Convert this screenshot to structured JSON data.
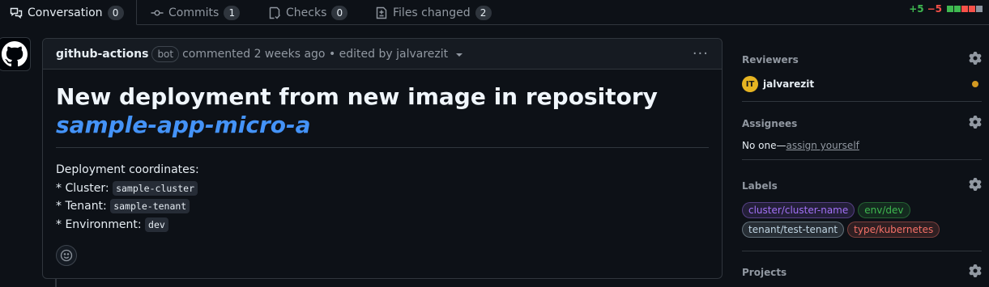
{
  "tabs": [
    {
      "label": "Conversation",
      "count": "0",
      "icon": "comment-discussion-icon",
      "active": true
    },
    {
      "label": "Commits",
      "count": "1",
      "icon": "git-commit-icon"
    },
    {
      "label": "Checks",
      "count": "0",
      "icon": "checklist-icon"
    },
    {
      "label": "Files changed",
      "count": "2",
      "icon": "file-diff-icon"
    }
  ],
  "diffstat": {
    "additions": "+5",
    "deletions": "−5",
    "blocks": [
      "#3fb950",
      "#3fb950",
      "#f85149",
      "#f85149",
      "#8b949e"
    ]
  },
  "comment": {
    "author": "github-actions",
    "badge": "bot",
    "meta": "commented 2 weeks ago • edited by jalvarezit",
    "heading": "New deployment from new image in repository ",
    "heading_link": "sample-app-micro-a",
    "coords_intro": "Deployment coordinates:",
    "rows": [
      {
        "prefix": "* Cluster: ",
        "value": "sample-cluster"
      },
      {
        "prefix": "* Tenant: ",
        "value": "sample-tenant"
      },
      {
        "prefix": "* Environment: ",
        "value": "dev"
      }
    ]
  },
  "sidebar": {
    "reviewers": {
      "title": "Reviewers",
      "name": "jalvarezit",
      "avatar_text": "IT"
    },
    "assignees": {
      "title": "Assignees",
      "none_text": "No one—",
      "link": "assign yourself"
    },
    "labels": {
      "title": "Labels",
      "items": [
        {
          "text": "cluster/cluster-name",
          "color": "#a371f7"
        },
        {
          "text": "env/dev",
          "color": "#3fb950"
        },
        {
          "text": "tenant/test-tenant",
          "color": "#bfd4e2"
        },
        {
          "text": "type/kubernetes",
          "color": "#f47067"
        }
      ]
    },
    "projects": {
      "title": "Projects"
    }
  },
  "colors": {
    "accent": "#4493f8",
    "background": "#0d1117",
    "border": "#30363d"
  }
}
